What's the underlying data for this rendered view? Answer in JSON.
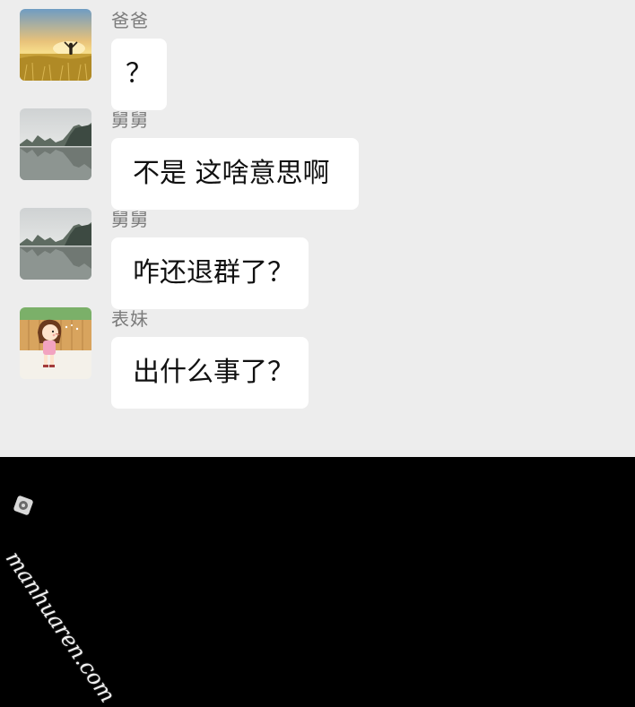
{
  "messages": [
    {
      "sender": "爸爸",
      "text": "？",
      "avatar": "sunrise-field-avatar"
    },
    {
      "sender": "舅舅",
      "text": "不是 这啥意思啊",
      "avatar": "lake-landscape-avatar"
    },
    {
      "sender": "舅舅",
      "text": "咋还退群了？",
      "avatar": "lake-landscape-avatar"
    },
    {
      "sender": "表妹",
      "text": "出什么事了？",
      "avatar": "cartoon-girl-avatar"
    }
  ],
  "watermark": {
    "text": "manhuaren.com"
  },
  "colors": {
    "chat_background": "#ededed",
    "bubble": "#ffffff",
    "sender_name": "#7b7b7b",
    "bottom_panel": "#000000"
  }
}
